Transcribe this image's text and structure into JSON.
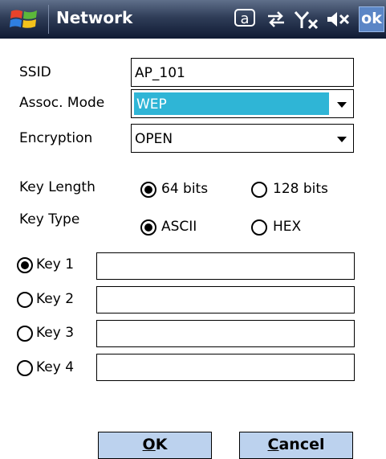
{
  "titlebar": {
    "title": "Network",
    "ok_label": "ok",
    "status_icons": [
      "at-icon",
      "sync-icon",
      "no-signal-icon",
      "speaker-muted-icon"
    ]
  },
  "form": {
    "ssid": {
      "label": "SSID",
      "value": "AP_101"
    },
    "assoc_mode": {
      "label": "Assoc. Mode",
      "value": "WEP"
    },
    "encryption": {
      "label": "Encryption",
      "value": "OPEN"
    },
    "key_length": {
      "label": "Key Length",
      "options": [
        "64 bits",
        "128 bits"
      ],
      "selected": "64 bits"
    },
    "key_type": {
      "label": "Key Type",
      "options": [
        "ASCII",
        "HEX"
      ],
      "selected": "ASCII"
    },
    "keys": [
      {
        "label": "Key 1",
        "selected": true,
        "value": ""
      },
      {
        "label": "Key 2",
        "selected": false,
        "value": ""
      },
      {
        "label": "Key 3",
        "selected": false,
        "value": ""
      },
      {
        "label": "Key 4",
        "selected": false,
        "value": ""
      }
    ]
  },
  "buttons": {
    "ok": {
      "mnemonic": "O",
      "rest": "K"
    },
    "cancel": {
      "mnemonic": "C",
      "rest": "ancel"
    }
  },
  "colors": {
    "selection": "#2fb5d6",
    "button_bg": "#bcd2ee",
    "ok_chip": "#5b86c6"
  }
}
